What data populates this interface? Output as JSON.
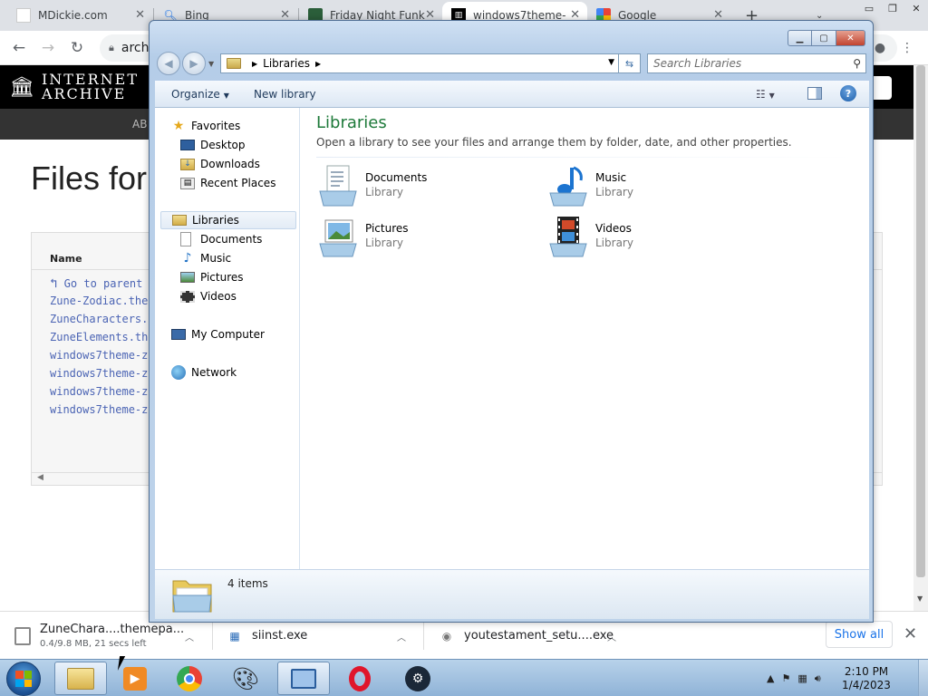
{
  "browser": {
    "tabs": [
      {
        "title": "MDickie.com",
        "icon": "mdickie-favicon"
      },
      {
        "title": "Bing",
        "icon": "bing-search-icon"
      },
      {
        "title": "Friday Night Funk",
        "icon": "fnf-favicon"
      },
      {
        "title": "windows7theme-",
        "icon": "archive-favicon",
        "active": true
      },
      {
        "title": "Google",
        "icon": "google-favicon"
      }
    ],
    "new_tab": "+",
    "url": "arch",
    "site": {
      "logo_line1": "INTERNET",
      "logo_line2": "ARCHIVE",
      "nav_text": "AB",
      "page_title": "Files for",
      "column_header": "Name",
      "files": [
        "Go to parent",
        "Zune-Zodiac.the",
        "ZuneCharacters.",
        "ZuneElements.th",
        "windows7theme-z",
        "windows7theme-z",
        "windows7theme-z",
        "windows7theme-z"
      ]
    },
    "downloads": [
      {
        "name": "ZuneChara....themepa...",
        "status": "0.4/9.8 MB, 21 secs left"
      },
      {
        "name": "siinst.exe",
        "status": ""
      },
      {
        "name": "youtestament_setu....exe",
        "status": ""
      }
    ],
    "show_all": "Show all"
  },
  "explorer": {
    "breadcrumb": "Libraries",
    "search_placeholder": "Search Libraries",
    "toolbar": {
      "organize": "Organize",
      "new_library": "New library",
      "help": "?"
    },
    "nav": {
      "favorites": "Favorites",
      "favorites_items": [
        "Desktop",
        "Downloads",
        "Recent Places"
      ],
      "libraries": "Libraries",
      "libraries_items": [
        "Documents",
        "Music",
        "Pictures",
        "Videos"
      ],
      "computer": "My Computer",
      "network": "Network"
    },
    "title": "Libraries",
    "description": "Open a library to see your files and arrange them by folder, date, and other properties.",
    "libraries": [
      {
        "name": "Documents",
        "type": "Library",
        "icon": "documents-library-icon"
      },
      {
        "name": "Music",
        "type": "Library",
        "icon": "music-library-icon"
      },
      {
        "name": "Pictures",
        "type": "Library",
        "icon": "pictures-library-icon"
      },
      {
        "name": "Videos",
        "type": "Library",
        "icon": "videos-library-icon"
      }
    ],
    "item_count": "4 items"
  },
  "taskbar": {
    "clock_time": "2:10 PM",
    "clock_date": "1/4/2023",
    "pinned": [
      "explorer-icon",
      "media-player-icon",
      "chrome-icon",
      "paint-icon",
      "remote-desktop-icon",
      "opera-icon",
      "steam-icon"
    ]
  },
  "colors": {
    "library_title": "#1e7a3a",
    "link": "#4b64b4",
    "accent_blue": "#1a73e8"
  }
}
